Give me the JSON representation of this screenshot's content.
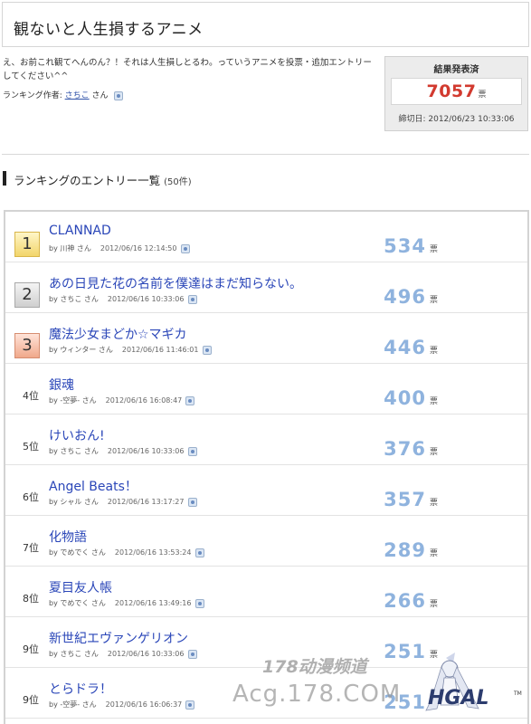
{
  "page_title": "観ないと人生損するアニメ",
  "description": "え、お前これ観てへんのん？！それは人生損しとるわ。っていうアニメを投票・追加エントリーしてください^^",
  "author": {
    "label": "ランキング作者:",
    "name": "さちこ",
    "suffix": "さん"
  },
  "result_box": {
    "title": "結果発表済",
    "count": "7057",
    "unit": "票",
    "deadline": "締切日: 2012/06/23 10:33:06"
  },
  "section": {
    "title": "ランキングのエントリー一覧",
    "count": "(50件)"
  },
  "entries": [
    {
      "rank": "1",
      "title": "CLANNAD",
      "by": "by 川神 さん",
      "date": "2012/06/16 12:14:50",
      "votes": "534",
      "unit": "票"
    },
    {
      "rank": "2",
      "title": "あの日見た花の名前を僕達はまだ知らない。",
      "by": "by さちこ さん",
      "date": "2012/06/16 10:33:06",
      "votes": "496",
      "unit": "票"
    },
    {
      "rank": "3",
      "title": "魔法少女まどか☆マギカ",
      "by": "by ウィンター さん",
      "date": "2012/06/16 11:46:01",
      "votes": "446",
      "unit": "票"
    },
    {
      "rank": "4位",
      "title": "銀魂",
      "by": "by -空夢- さん",
      "date": "2012/06/16 16:08:47",
      "votes": "400",
      "unit": "票"
    },
    {
      "rank": "5位",
      "title": "けいおん!",
      "by": "by さちこ さん",
      "date": "2012/06/16 10:33:06",
      "votes": "376",
      "unit": "票"
    },
    {
      "rank": "6位",
      "title": "Angel Beats！",
      "by": "by シャル さん",
      "date": "2012/06/16 13:17:27",
      "votes": "357",
      "unit": "票"
    },
    {
      "rank": "7位",
      "title": "化物語",
      "by": "by でめでく さん",
      "date": "2012/06/16 13:53:24",
      "votes": "289",
      "unit": "票"
    },
    {
      "rank": "8位",
      "title": "夏目友人帳",
      "by": "by でめでく さん",
      "date": "2012/06/16 13:49:16",
      "votes": "266",
      "unit": "票"
    },
    {
      "rank": "9位",
      "title": "新世紀エヴァンゲリオン",
      "by": "by さちこ さん",
      "date": "2012/06/16 10:33:06",
      "votes": "251",
      "unit": "票"
    },
    {
      "rank": "9位",
      "title": "とらドラ！",
      "by": "by -空夢- さん",
      "date": "2012/06/16 16:06:37",
      "votes": "251",
      "unit": "票"
    }
  ],
  "watermark": {
    "line1": "178动漫频道",
    "line2": "Acg.178.COM",
    "logo": "HGAL",
    "tm": "TM"
  }
}
